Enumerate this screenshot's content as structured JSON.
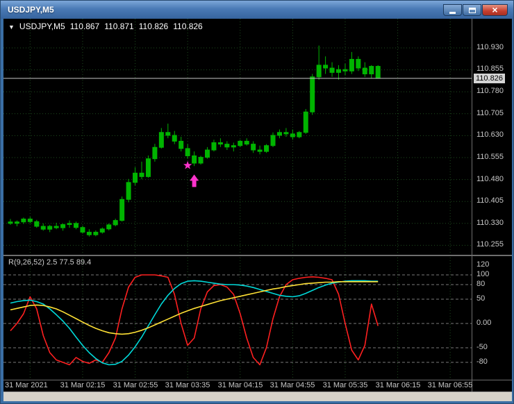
{
  "window": {
    "title": "USDJPY,M5",
    "close_glyph": "×"
  },
  "chart": {
    "dropdown_icon": "▼",
    "symbol": "USDJPY,M5",
    "open": "110.867",
    "high": "110.871",
    "low": "110.826",
    "close": "110.826",
    "current_price": "110.826",
    "indicator_label": "R(9,26,52) 2.5 77.5 89.4",
    "price_axis": [
      "110.930",
      "110.855",
      "110.780",
      "110.705",
      "110.630",
      "110.555",
      "110.480",
      "110.405",
      "110.330",
      "110.255"
    ],
    "indicator_axis": [
      "120",
      "100",
      "80",
      "50",
      "0.00",
      "-50",
      "-80"
    ],
    "time_axis": [
      "31 Mar 2021",
      "31 Mar 02:15",
      "31 Mar 02:55",
      "31 Mar 03:35",
      "31 Mar 04:15",
      "31 Mar 04:55",
      "31 Mar 05:35",
      "31 Mar 06:15",
      "31 Mar 06:55"
    ]
  },
  "colors": {
    "candle": "#00b400",
    "grid": "#1e4d1e",
    "level": "#7a7a7a",
    "separator": "#6e6e6e",
    "price_line": "#c8c8c8",
    "signal": "#ff33cc",
    "ind_red": "#ff2020",
    "ind_cyan": "#00d9d9",
    "ind_yellow": "#ffe135"
  },
  "chart_data": {
    "type": "candlestick",
    "symbol": "USDJPY",
    "timeframe": "M5",
    "title": "USDJPY,M5",
    "price_axis_range": [
      110.255,
      110.93
    ],
    "current_price": 110.826,
    "ohlc_current": [
      110.867,
      110.871,
      110.826,
      110.826
    ],
    "candles": [
      [
        110.335,
        110.345,
        110.325,
        110.33
      ],
      [
        110.33,
        110.34,
        110.32,
        110.335
      ],
      [
        110.335,
        110.35,
        110.328,
        110.345
      ],
      [
        110.345,
        110.352,
        110.33,
        110.336
      ],
      [
        110.336,
        110.342,
        110.315,
        110.32
      ],
      [
        110.32,
        110.33,
        110.305,
        110.31
      ],
      [
        110.31,
        110.325,
        110.3,
        110.32
      ],
      [
        110.32,
        110.332,
        110.31,
        110.315
      ],
      [
        110.315,
        110.33,
        110.305,
        110.326
      ],
      [
        110.326,
        110.34,
        110.315,
        110.33
      ],
      [
        110.33,
        110.336,
        110.31,
        110.316
      ],
      [
        110.316,
        110.322,
        110.295,
        110.3
      ],
      [
        110.3,
        110.31,
        110.285,
        110.291
      ],
      [
        110.291,
        110.306,
        110.286,
        110.3
      ],
      [
        110.3,
        110.316,
        110.295,
        110.311
      ],
      [
        110.311,
        110.33,
        110.306,
        110.325
      ],
      [
        110.325,
        110.346,
        110.32,
        110.34
      ],
      [
        110.34,
        110.422,
        110.336,
        110.412
      ],
      [
        110.412,
        110.482,
        110.402,
        110.47
      ],
      [
        110.47,
        110.522,
        110.46,
        110.502
      ],
      [
        110.502,
        110.541,
        110.481,
        110.49
      ],
      [
        110.49,
        110.562,
        110.486,
        110.551
      ],
      [
        110.551,
        110.602,
        110.541,
        110.59
      ],
      [
        110.59,
        110.656,
        110.586,
        110.641
      ],
      [
        110.641,
        110.671,
        110.621,
        110.631
      ],
      [
        110.631,
        110.646,
        110.601,
        110.611
      ],
      [
        110.611,
        110.626,
        110.576,
        110.586
      ],
      [
        110.586,
        110.601,
        110.551,
        110.561
      ],
      [
        110.561,
        110.576,
        110.526,
        110.536
      ],
      [
        110.536,
        110.561,
        110.531,
        110.556
      ],
      [
        110.556,
        110.591,
        110.551,
        110.581
      ],
      [
        110.581,
        110.616,
        110.576,
        110.606
      ],
      [
        110.606,
        110.621,
        110.591,
        110.601
      ],
      [
        110.601,
        110.611,
        110.581,
        110.591
      ],
      [
        110.591,
        110.606,
        110.576,
        110.596
      ],
      [
        110.596,
        110.616,
        110.591,
        110.611
      ],
      [
        110.611,
        110.621,
        110.596,
        110.601
      ],
      [
        110.601,
        110.611,
        110.571,
        110.581
      ],
      [
        110.581,
        110.596,
        110.566,
        110.576
      ],
      [
        110.576,
        110.601,
        110.571,
        110.596
      ],
      [
        110.596,
        110.641,
        110.591,
        110.631
      ],
      [
        110.631,
        110.651,
        110.621,
        110.641
      ],
      [
        110.641,
        110.656,
        110.626,
        110.636
      ],
      [
        110.636,
        110.651,
        110.616,
        110.626
      ],
      [
        110.626,
        110.646,
        110.621,
        110.641
      ],
      [
        110.641,
        110.721,
        110.636,
        110.711
      ],
      [
        110.711,
        110.841,
        110.701,
        110.831
      ],
      [
        110.831,
        110.938,
        110.821,
        110.871
      ],
      [
        110.871,
        110.901,
        110.841,
        110.861
      ],
      [
        110.861,
        110.881,
        110.831,
        110.846
      ],
      [
        110.846,
        110.871,
        110.821,
        110.856
      ],
      [
        110.856,
        110.876,
        110.836,
        110.851
      ],
      [
        110.851,
        110.916,
        110.841,
        110.891
      ],
      [
        110.891,
        110.901,
        110.851,
        110.861
      ],
      [
        110.861,
        110.881,
        110.831,
        110.841
      ],
      [
        110.841,
        110.871,
        110.826,
        110.867
      ],
      [
        110.867,
        110.871,
        110.826,
        110.826
      ]
    ],
    "signals": [
      {
        "shape": "star",
        "index": 27,
        "price": 110.528
      },
      {
        "shape": "arrow-up",
        "index": 28,
        "price": 110.497
      }
    ],
    "indicator": {
      "type": "line",
      "name": "R(9,26,52)",
      "params": "2.5 77.5 89.4",
      "range": [
        -120,
        120
      ],
      "levels": [
        100,
        80,
        50,
        0,
        -50,
        -80
      ],
      "series": [
        {
          "name": "fast",
          "color_key": "ind_red",
          "values": [
            -15,
            0,
            20,
            55,
            30,
            -25,
            -60,
            -75,
            -80,
            -85,
            -70,
            -78,
            -82,
            -75,
            -80,
            -60,
            -30,
            30,
            75,
            95,
            100,
            100,
            100,
            98,
            95,
            60,
            0,
            -45,
            -30,
            30,
            65,
            78,
            80,
            75,
            60,
            20,
            -30,
            -70,
            -85,
            -50,
            10,
            55,
            80,
            90,
            93,
            95,
            96,
            95,
            93,
            90,
            60,
            0,
            -55,
            -75,
            -45,
            40,
            -5
          ]
        },
        {
          "name": "mid",
          "color_key": "ind_cyan",
          "values": [
            42,
            45,
            47,
            48,
            45,
            40,
            30,
            18,
            5,
            -10,
            -28,
            -45,
            -60,
            -72,
            -81,
            -85,
            -84,
            -78,
            -65,
            -48,
            -28,
            -5,
            18,
            40,
            58,
            72,
            82,
            87,
            88,
            87,
            85,
            83,
            81,
            80,
            80,
            79,
            77,
            74,
            70,
            66,
            62,
            58,
            56,
            55,
            57,
            62,
            68,
            74,
            79,
            83,
            85,
            87,
            88,
            88,
            88,
            87,
            87
          ]
        },
        {
          "name": "slow",
          "color_key": "ind_yellow",
          "values": [
            28,
            31,
            34,
            37,
            38,
            37,
            34,
            30,
            24,
            17,
            10,
            3,
            -4,
            -10,
            -15,
            -19,
            -21,
            -22,
            -21,
            -18,
            -14,
            -9,
            -3,
            3,
            9,
            15,
            21,
            26,
            31,
            35,
            39,
            43,
            47,
            50,
            53,
            56,
            59,
            62,
            65,
            68,
            71,
            73,
            76,
            78,
            80,
            82,
            83,
            84,
            85,
            85,
            86,
            86,
            86,
            86,
            86,
            86,
            86
          ]
        }
      ]
    }
  }
}
